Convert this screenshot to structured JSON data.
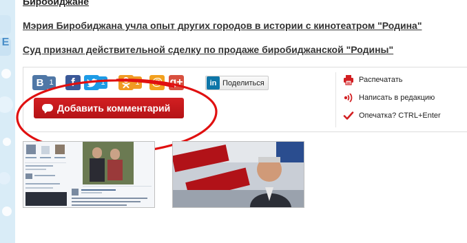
{
  "page": {
    "cut_title": "Биробиджане"
  },
  "links": [
    {
      "text": "Мэрия Биробиджана учла опыт других городов в истории с кинотеатром \"Родина\""
    },
    {
      "text": "Суд признал действительной сделку по продаже биробиджанской \"Родины\""
    }
  ],
  "social": {
    "vk": {
      "glyph": "B",
      "count": "1",
      "color": "#4f77a6"
    },
    "facebook": {
      "glyph": "f",
      "color": "#3b5998"
    },
    "twitter": {
      "glyph": "t",
      "count": "1",
      "color": "#1d9be6"
    },
    "odnoklassniki": {
      "glyph": "ok",
      "count": "1",
      "color": "#f09a24"
    },
    "mailru": {
      "glyph": "@",
      "color": "#f2a01e"
    },
    "googleplus": {
      "glyph": "g+",
      "color": "#d8503f"
    },
    "linkedin": {
      "glyph": "in",
      "label": "Поделиться",
      "color": "#0e76a8"
    }
  },
  "comment_button": {
    "label": "Добавить комментарий",
    "icon": "speech-bubble-icon",
    "color": "#c41a1d"
  },
  "actions": [
    {
      "label": "Распечатать",
      "icon": "printer-icon"
    },
    {
      "label": "Написать в редакцию",
      "icon": "broadcast-icon"
    },
    {
      "label": "Опечатка? CTRL+Enter",
      "icon": "checkmark-icon"
    }
  ],
  "annotation": {
    "shape": "hand-drawn ellipse",
    "color": "#e01010"
  },
  "thumbnails": [
    {
      "kind": "social-network-page-screenshot"
    },
    {
      "kind": "news-photo-man-cinema-sign"
    }
  ]
}
